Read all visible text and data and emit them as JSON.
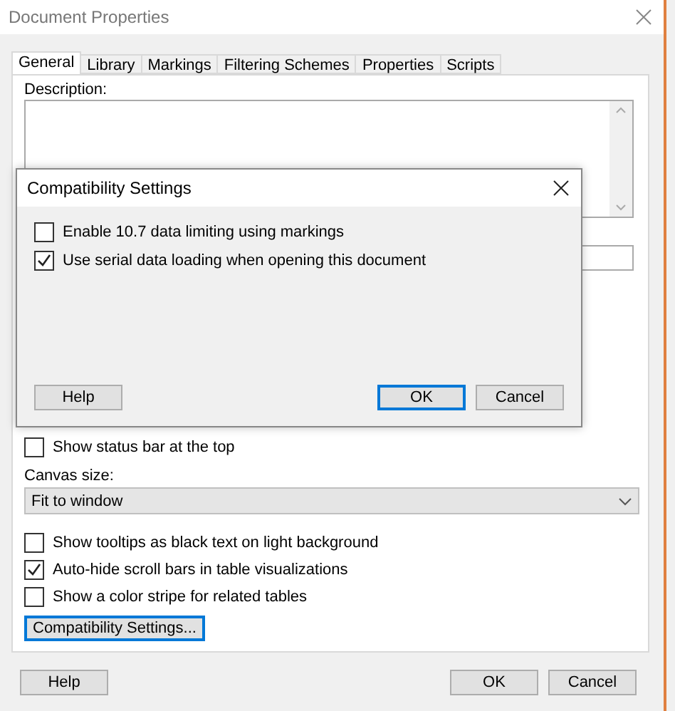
{
  "window": {
    "title": "Document Properties"
  },
  "tabs": [
    {
      "label": "General",
      "selected": true
    },
    {
      "label": "Library",
      "selected": false
    },
    {
      "label": "Markings",
      "selected": false
    },
    {
      "label": "Filtering Schemes",
      "selected": false
    },
    {
      "label": "Properties",
      "selected": false
    },
    {
      "label": "Scripts",
      "selected": false
    }
  ],
  "description": {
    "label": "Description:"
  },
  "status_bar_option": {
    "label": "Show status bar at the top",
    "checked": false
  },
  "canvas_size": {
    "label": "Canvas size:",
    "value": "Fit to window"
  },
  "options": [
    {
      "label": "Show tooltips as black text on light background",
      "checked": false
    },
    {
      "label": "Auto-hide scroll bars in table visualizations",
      "checked": true
    },
    {
      "label": "Show a color stripe for related tables",
      "checked": false
    }
  ],
  "compatibility_button": {
    "label": "Compatibility Settings...",
    "focused": true
  },
  "buttons": [
    {
      "label": "Help",
      "focused": false
    },
    {
      "label": "OK",
      "focused": false
    },
    {
      "label": "Cancel",
      "focused": false
    }
  ],
  "dialog": {
    "title": "Compatibility Settings",
    "options": [
      {
        "label": "Enable 10.7 data limiting using markings",
        "checked": false
      },
      {
        "label": "Use serial data loading when opening this document",
        "checked": true
      }
    ],
    "buttons": [
      {
        "label": "Help",
        "focused": false
      },
      {
        "label": "OK",
        "focused": true
      },
      {
        "label": "Cancel",
        "focused": false
      }
    ]
  }
}
